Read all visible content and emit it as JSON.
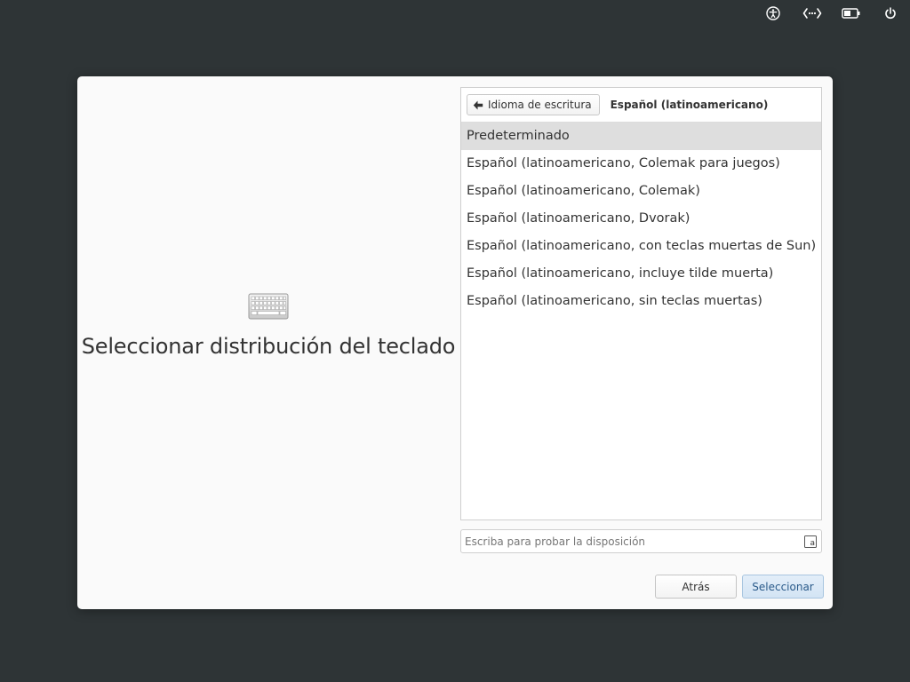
{
  "panel": {
    "indicators": [
      {
        "icon": "accessibility-icon"
      },
      {
        "icon": "network-icon"
      },
      {
        "icon": "battery-icon"
      },
      {
        "icon": "power-icon"
      }
    ]
  },
  "left": {
    "icon": "keyboard-icon",
    "title": "Seleccionar distribución del teclado"
  },
  "list": {
    "back_label": "Idioma de escritura",
    "header_title": "Español (latinoamericano)",
    "items": [
      "Predeterminado",
      "Español (latinoamericano, Colemak para juegos)",
      "Español (latinoamericano, Colemak)",
      "Español (latinoamericano, Dvorak)",
      "Español (latinoamericano, con teclas muertas de Sun)",
      "Español (latinoamericano, incluye tilde muerta)",
      "Español (latinoamericano, sin teclas muertas)"
    ],
    "selected_index": 0
  },
  "test_input": {
    "placeholder": "Escriba para probar la disposición",
    "value": ""
  },
  "buttons": {
    "back": "Atrás",
    "select": "Seleccionar"
  },
  "colors": {
    "background": "#2e3436",
    "dialog": "#fafafa",
    "selected_row": "#dedede",
    "accent_button": "#d3e4f4",
    "accent_text": "#2a5a8a"
  }
}
